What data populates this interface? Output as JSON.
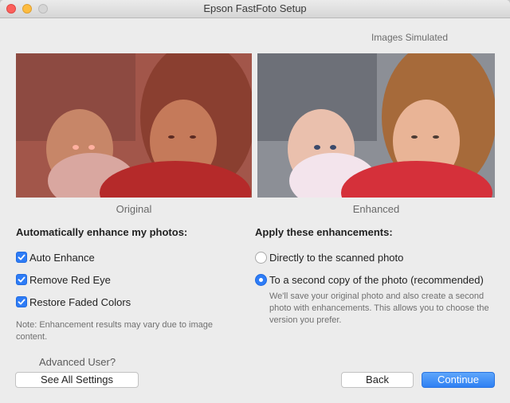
{
  "window": {
    "title": "Epson FastFoto Setup"
  },
  "preview": {
    "simulated_label": "Images Simulated",
    "original_caption": "Original",
    "enhanced_caption": "Enhanced"
  },
  "left_panel": {
    "heading": "Automatically enhance my photos:",
    "options": [
      {
        "label": "Auto Enhance",
        "checked": true
      },
      {
        "label": "Remove Red Eye",
        "checked": true
      },
      {
        "label": "Restore Faded Colors",
        "checked": true
      }
    ],
    "note": "Note: Enhancement results may vary due to image content.",
    "advanced_label": "Advanced User?",
    "see_all_button": "See All Settings"
  },
  "right_panel": {
    "heading": "Apply these enhancements:",
    "options": [
      {
        "label": "Directly to the scanned photo",
        "selected": false
      },
      {
        "label": "To a second copy of the photo (recommended)",
        "selected": true
      }
    ],
    "description": "We'll save your original photo and also create a second photo with enhancements. This allows you to choose the version you prefer."
  },
  "footer": {
    "back_button": "Back",
    "continue_button": "Continue"
  },
  "colors": {
    "accent": "#2e7cf6",
    "window_bg": "#ececec"
  }
}
